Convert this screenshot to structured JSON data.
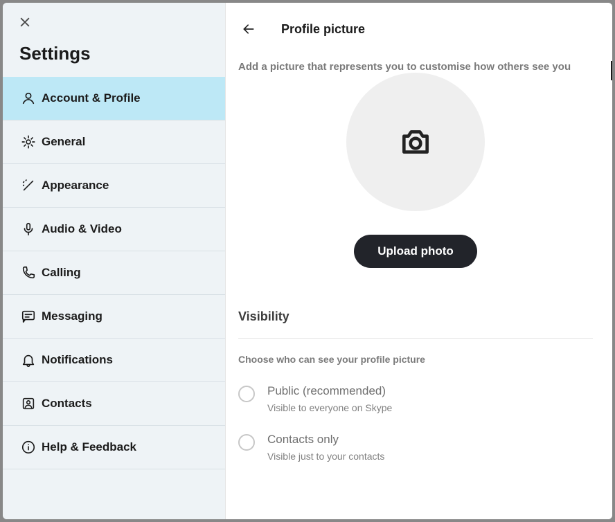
{
  "sidebar": {
    "title": "Settings",
    "items": [
      {
        "id": "account-profile",
        "label": "Account & Profile",
        "icon": "person-icon",
        "active": true
      },
      {
        "id": "general",
        "label": "General",
        "icon": "gear-icon"
      },
      {
        "id": "appearance",
        "label": "Appearance",
        "icon": "wand-icon"
      },
      {
        "id": "audio-video",
        "label": "Audio & Video",
        "icon": "mic-icon"
      },
      {
        "id": "calling",
        "label": "Calling",
        "icon": "phone-icon"
      },
      {
        "id": "messaging",
        "label": "Messaging",
        "icon": "message-icon"
      },
      {
        "id": "notifications",
        "label": "Notifications",
        "icon": "bell-icon"
      },
      {
        "id": "contacts",
        "label": "Contacts",
        "icon": "contact-icon"
      },
      {
        "id": "help-feedback",
        "label": "Help & Feedback",
        "icon": "info-icon"
      }
    ]
  },
  "main": {
    "title": "Profile picture",
    "subtitle": "Add a picture that represents you to customise how others see you",
    "upload_button": "Upload photo",
    "visibility": {
      "heading": "Visibility",
      "description": "Choose who can see your profile picture",
      "options": [
        {
          "id": "public",
          "label": "Public (recommended)",
          "description": "Visible to everyone on Skype",
          "selected": false
        },
        {
          "id": "contacts",
          "label": "Contacts only",
          "description": "Visible just to your contacts",
          "selected": false
        }
      ]
    }
  }
}
